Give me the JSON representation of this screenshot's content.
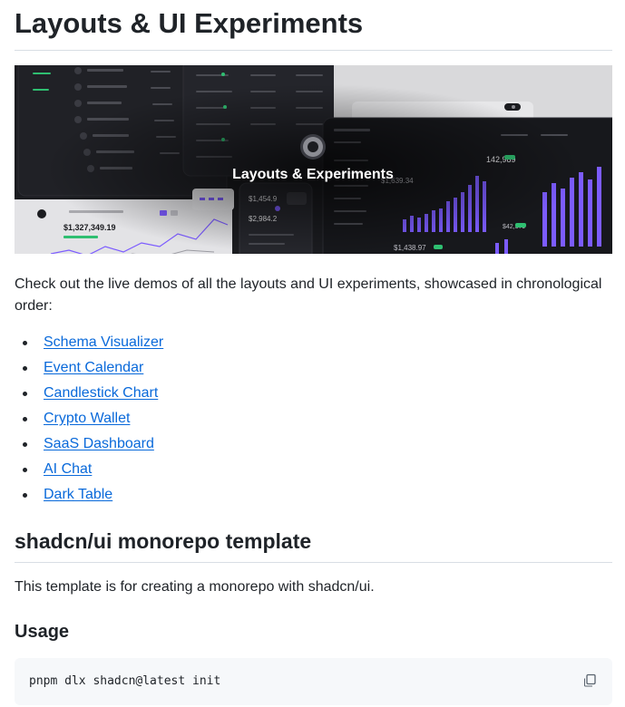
{
  "page": {
    "title": "Layouts & UI Experiments",
    "banner": {
      "title": "Layouts & Experiments",
      "figures": [
        "$1,327,349.19",
        "$1,454.9",
        "$2,984.2",
        "$1,639.34",
        "$1,438.97",
        "142,989",
        "$42,379"
      ]
    },
    "intro": "Check out the live demos of all the layouts and UI experiments, showcased in chronological order:",
    "links": [
      "Schema Visualizer",
      "Event Calendar",
      "Candlestick Chart",
      "Crypto Wallet",
      "SaaS Dashboard",
      "AI Chat",
      "Dark Table"
    ],
    "section_title": "shadcn/ui monorepo template",
    "section_text": "This template is for creating a monorepo with shadcn/ui.",
    "usage_title": "Usage",
    "code": "pnpm dlx shadcn@latest init"
  },
  "colors": {
    "link": "#0969da",
    "text": "#1f2328",
    "banner_bg": "#1b1c20",
    "accent_purple": "#7c5cff",
    "accent_green": "#2fbf71",
    "code_bg": "#f6f8fa"
  },
  "icons": [
    "layers-logo-icon",
    "copy-icon"
  ]
}
